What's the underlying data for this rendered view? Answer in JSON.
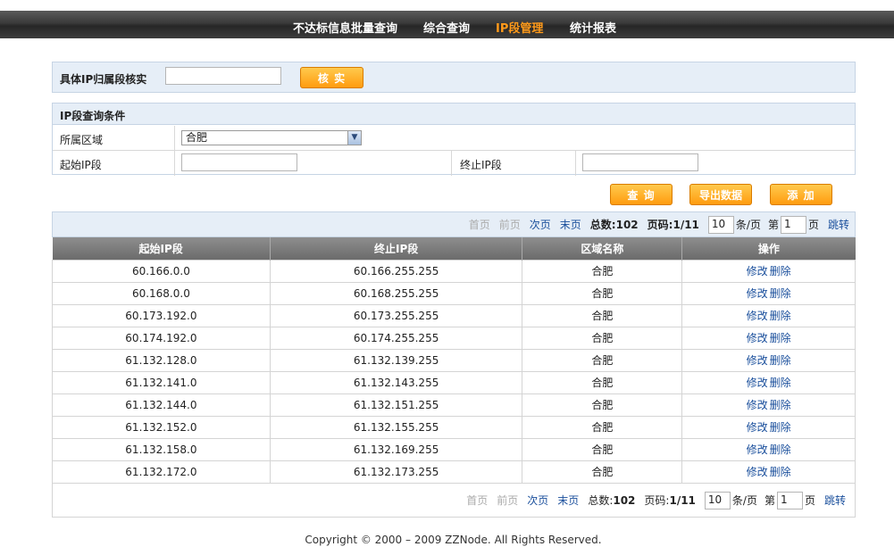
{
  "nav": {
    "items": [
      "不达标信息批量查询",
      "综合查询",
      "IP段管理",
      "统计报表"
    ],
    "active": 2
  },
  "verify": {
    "label": "具体IP归属段核实",
    "input_value": "",
    "button": "核 实"
  },
  "conditions": {
    "title": "IP段查询条件",
    "region_label": "所属区域",
    "region_value": "合肥",
    "start_label": "起始IP段",
    "start_value": "",
    "end_label": "终止IP段",
    "end_value": ""
  },
  "actions": {
    "query": "查 询",
    "export": "导出数据",
    "add": "添 加"
  },
  "pager": {
    "first": "首页",
    "prev": "前页",
    "next": "次页",
    "last": "末页",
    "total_label": "总数:",
    "total": "102",
    "page_label": "页码:",
    "page": "1/11",
    "per_page": "10",
    "per_page_unit": "条/页",
    "goto_prefix": "第",
    "goto_value": "1",
    "goto_suffix": "页",
    "jump": "跳转"
  },
  "table": {
    "columns": [
      "起始IP段",
      "终止IP段",
      "区域名称",
      "操作"
    ],
    "edit": "修改",
    "delete": "删除",
    "rows": [
      [
        "60.166.0.0",
        "60.166.255.255",
        "合肥"
      ],
      [
        "60.168.0.0",
        "60.168.255.255",
        "合肥"
      ],
      [
        "60.173.192.0",
        "60.173.255.255",
        "合肥"
      ],
      [
        "60.174.192.0",
        "60.174.255.255",
        "合肥"
      ],
      [
        "61.132.128.0",
        "61.132.139.255",
        "合肥"
      ],
      [
        "61.132.141.0",
        "61.132.143.255",
        "合肥"
      ],
      [
        "61.132.144.0",
        "61.132.151.255",
        "合肥"
      ],
      [
        "61.132.152.0",
        "61.132.155.255",
        "合肥"
      ],
      [
        "61.132.158.0",
        "61.132.169.255",
        "合肥"
      ],
      [
        "61.132.172.0",
        "61.132.173.255",
        "合肥"
      ]
    ]
  },
  "footer": "Copyright © 2000 – 2009 ZZNode. All Rights Reserved.",
  "colors": {
    "accent": "#ff9a1a",
    "link": "#1a4f9c",
    "panel": "#e6eef7"
  }
}
